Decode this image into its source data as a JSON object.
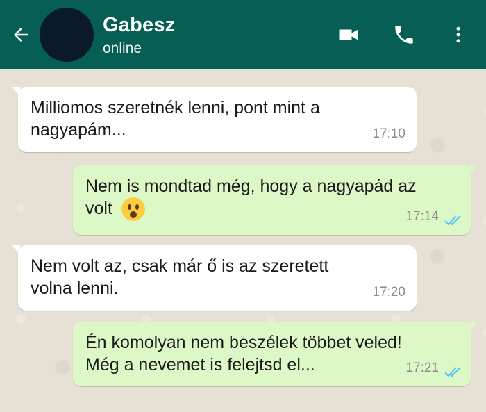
{
  "header": {
    "contact_name": "Gabesz",
    "status": "online",
    "icons": {
      "back": "arrow-back-icon",
      "video": "video-call-icon",
      "call": "phone-icon",
      "menu": "more-vert-icon"
    },
    "background_color": "#075e54"
  },
  "messages": [
    {
      "direction": "incoming",
      "text_line1": "Milliomos szeretnék lenni, pont mint a",
      "text_line2": "nagyapám...",
      "time": "17:10"
    },
    {
      "direction": "outgoing",
      "text_line1": "Nem is mondtad még, hogy a nagyapád az",
      "text_line2": "volt",
      "emoji": "hushed-face-icon",
      "time": "17:14",
      "read": true
    },
    {
      "direction": "incoming",
      "text_line1": "Nem volt az, csak már ő is az szeretett",
      "text_line2": "volna lenni.",
      "time": "17:20"
    },
    {
      "direction": "outgoing",
      "text_line1": "Én komolyan nem beszélek többet veled!",
      "text_line2": "Még a nevemet is felejtsd el...",
      "time": "17:21",
      "read": true
    }
  ],
  "colors": {
    "incoming_bubble": "#ffffff",
    "outgoing_bubble": "#dcf8c6",
    "read_ticks": "#4fc3f7"
  }
}
